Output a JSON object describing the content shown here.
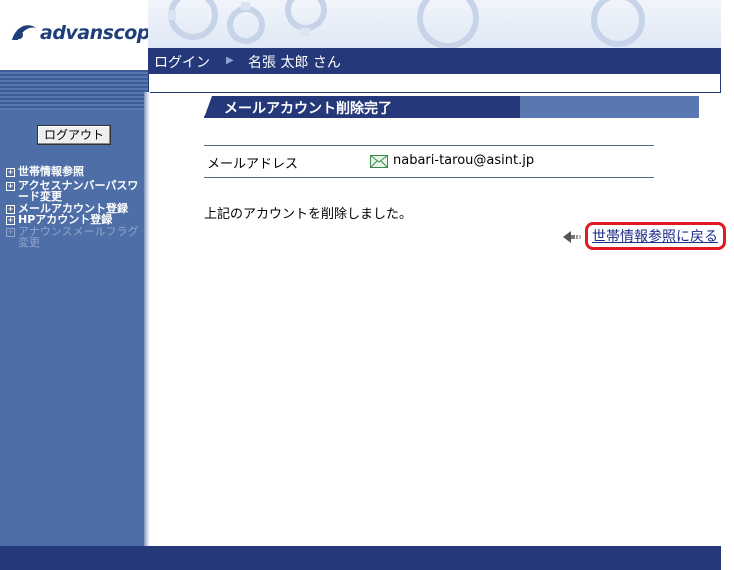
{
  "brand": {
    "logo_text": "advanscope"
  },
  "header": {
    "login_label": "ログイン",
    "user_name": "名張 太郎 さん"
  },
  "sidebar": {
    "logout_label": "ログアウト",
    "items": [
      {
        "label": "世帯情報参照",
        "enabled": true
      },
      {
        "label": "アクセスナンバーパスワード変更",
        "enabled": true
      },
      {
        "label": "メールアカウント登録",
        "enabled": true
      },
      {
        "label": "HPアカウント登録",
        "enabled": true
      },
      {
        "label": "アナウンスメールフラグ変更",
        "enabled": false
      }
    ]
  },
  "page": {
    "title": "メールアカウント削除完了",
    "field_label": "メールアドレス",
    "field_value": "nabari-tarou@asint.jp",
    "message": "上記のアカウントを削除しました。",
    "back_link": "世帯情報参照に戻る"
  },
  "colors": {
    "navy": "#25397a",
    "sidebar": "#4d6ea7",
    "highlight": "#e01a24",
    "link": "#1d2e8c"
  }
}
